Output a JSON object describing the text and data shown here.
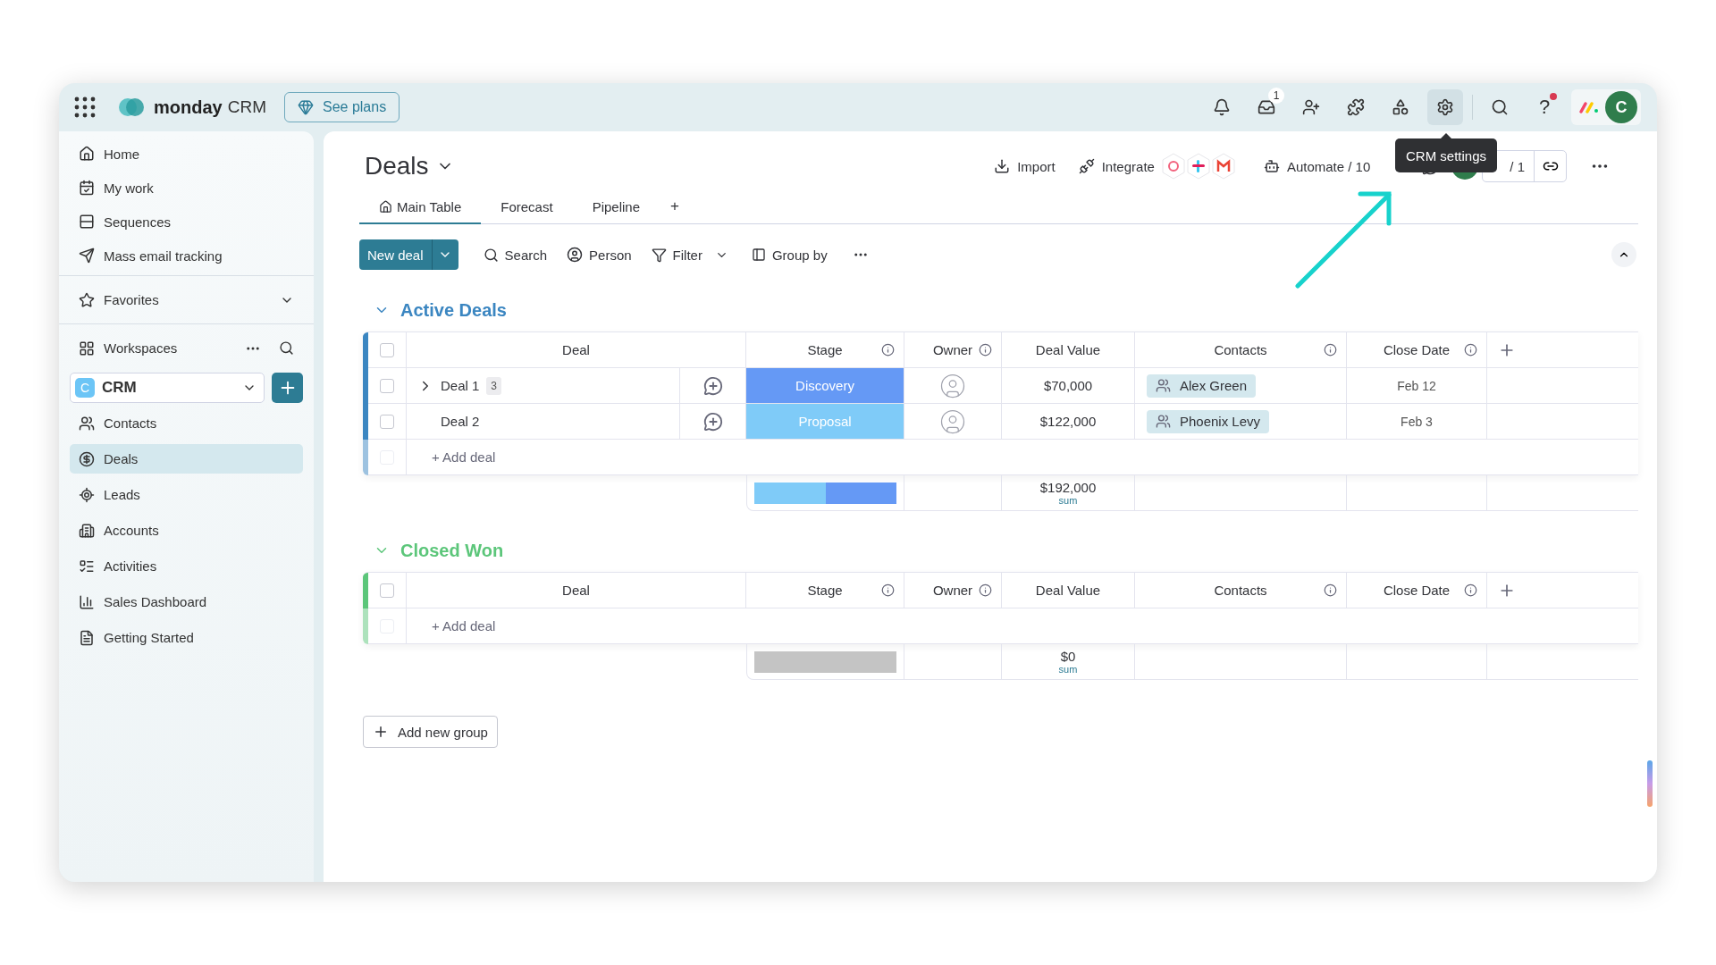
{
  "topbar": {
    "brand": "monday",
    "product": "CRM",
    "plans_button": "See plans",
    "actions": [
      {
        "selected": false
      },
      {
        "selected": false,
        "badge": "1"
      },
      {
        "selected": false
      },
      {
        "selected": false
      },
      {
        "selected": false
      },
      {
        "selected": true
      }
    ],
    "help": "?",
    "help_notification": true,
    "avatar": "C"
  },
  "tooltip": "CRM settings",
  "sidebar": {
    "nav": [
      {
        "label": "Home",
        "selected": false
      },
      {
        "label": "My work",
        "selected": false
      },
      {
        "label": "Sequences",
        "selected": false
      },
      {
        "label": "Mass email tracking",
        "selected": false
      }
    ],
    "favorites": "Favorites",
    "workspaces": "Workspaces",
    "workspace": {
      "initial": "C",
      "name": "CRM"
    },
    "items": [
      {
        "label": "Contacts",
        "selected": false
      },
      {
        "label": "Deals",
        "selected": true
      },
      {
        "label": "Leads",
        "selected": false
      },
      {
        "label": "Accounts",
        "selected": false
      },
      {
        "label": "Activities",
        "selected": false
      },
      {
        "label": "Sales Dashboard",
        "selected": false
      },
      {
        "label": "Getting Started",
        "selected": false
      }
    ]
  },
  "board": {
    "title": "Deals",
    "import": "Import",
    "integrate": "Integrate",
    "automate": "Automate / 10",
    "members": "/ 1",
    "tabs": [
      {
        "label": "Main Table",
        "selected": true
      },
      {
        "label": "Forecast",
        "selected": false
      },
      {
        "label": "Pipeline",
        "selected": false
      }
    ],
    "add_tab": "+",
    "toolbar": {
      "new_item": "New deal",
      "search": "Search",
      "person": "Person",
      "filter": "Filter",
      "group_by": "Group by"
    },
    "groups": [
      {
        "title": "Active Deals",
        "color": "#3b86c1",
        "all_checked": false,
        "columns": [
          {
            "label": "Deal",
            "info": false
          },
          {
            "label": "Stage",
            "info": true
          },
          {
            "label": "Owner",
            "info": true
          },
          {
            "label": "Deal Value",
            "info": false
          },
          {
            "label": "Contacts",
            "info": true
          },
          {
            "label": "Close Date",
            "info": true
          }
        ],
        "rows": [
          {
            "checked": false,
            "name": "Deal 1",
            "subitems": "3",
            "stage": {
              "label": "Discovery",
              "color": "#6599f5"
            },
            "value": "$70,000",
            "contact": "Alex Green",
            "close_date": "Feb 12"
          },
          {
            "checked": false,
            "name": "Deal 2",
            "stage": {
              "label": "Proposal",
              "color": "#7fcbf8"
            },
            "value": "$122,000",
            "contact": "Phoenix Levy",
            "close_date": "Feb 3"
          }
        ],
        "add_item": "+ Add deal",
        "add_checked": false,
        "summary": {
          "segments": [
            {
              "color": "#7fcbf8",
              "level": 0.5
            },
            {
              "color": "#6599f5",
              "level": 0.5
            }
          ],
          "total": "$192,000",
          "total_label": "sum"
        }
      },
      {
        "title": "Closed Won",
        "color": "#5cc67a",
        "all_checked": false,
        "columns": [
          {
            "label": "Deal",
            "info": false
          },
          {
            "label": "Stage",
            "info": true
          },
          {
            "label": "Owner",
            "info": true
          },
          {
            "label": "Deal Value",
            "info": false
          },
          {
            "label": "Contacts",
            "info": true
          },
          {
            "label": "Close Date",
            "info": true
          }
        ],
        "add_item": "+ Add deal",
        "add_checked": false,
        "summary": {
          "total": "$0",
          "total_label": "sum"
        }
      }
    ],
    "add_group": "Add new group"
  }
}
